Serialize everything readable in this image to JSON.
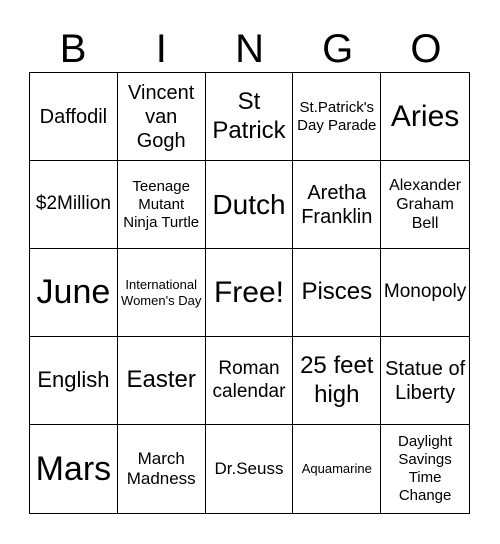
{
  "header": [
    "B",
    "I",
    "N",
    "G",
    "O"
  ],
  "cells": [
    "Daffodil",
    "Vincent van Gogh",
    "St Patrick",
    "St.Patrick's Day Parade",
    "Aries",
    "$2Million",
    "Teenage Mutant Ninja Turtle",
    "Dutch",
    "Aretha Franklin",
    "Alexander Graham Bell",
    "June",
    "International Women's Day",
    "Free!",
    "Pisces",
    "Monopoly",
    "English",
    "Easter",
    "Roman calendar",
    "25 feet high",
    "Statue of Liberty",
    "Mars",
    "March Madness",
    "Dr.Seuss",
    "Aquamarine",
    "Daylight Savings Time Change"
  ]
}
